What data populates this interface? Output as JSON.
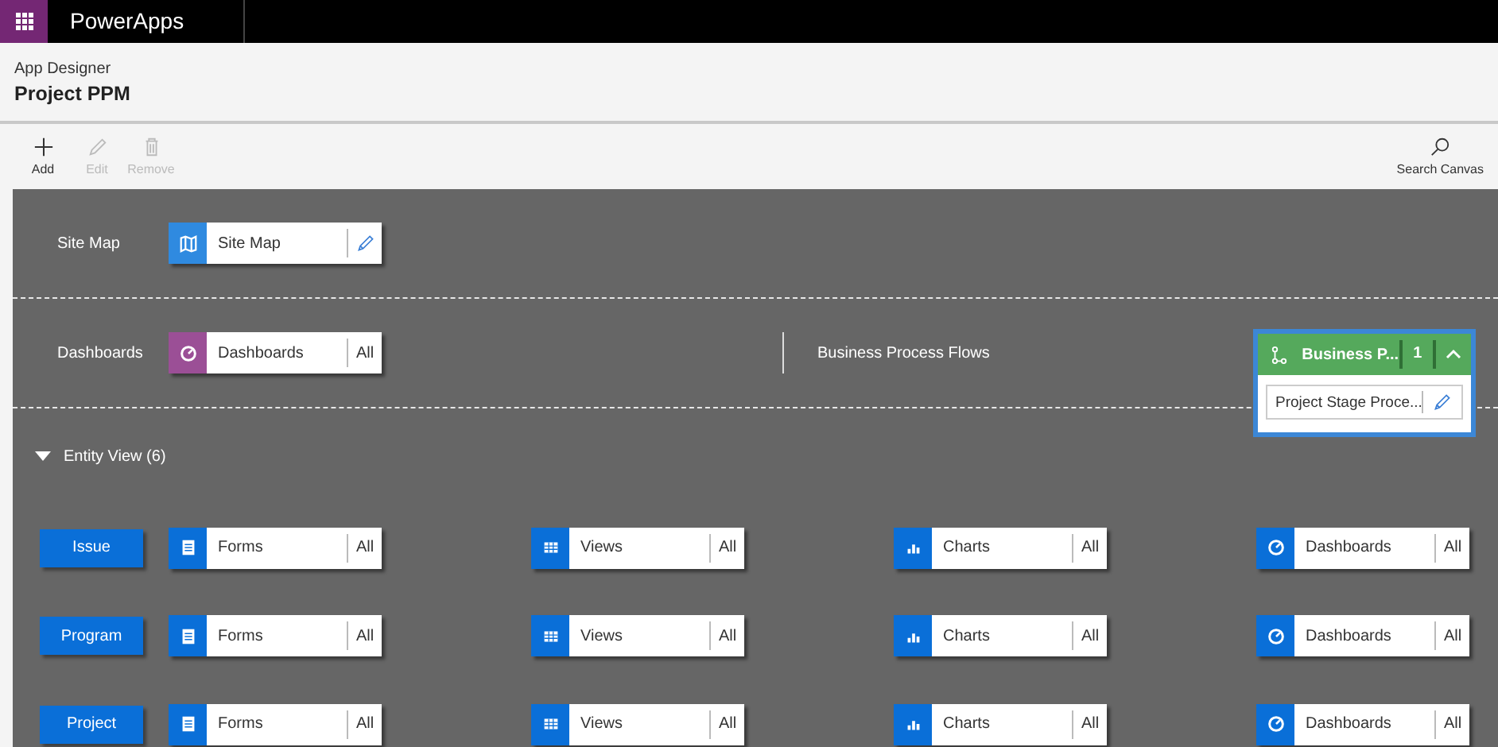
{
  "top_bar": {
    "app_name": "PowerApps"
  },
  "header": {
    "subtitle": "App Designer",
    "title": "Project PPM"
  },
  "toolbar": {
    "buttons": [
      {
        "label": "Add",
        "kind": "add",
        "disabled": false
      },
      {
        "label": "Edit",
        "kind": "edit",
        "disabled": true
      },
      {
        "label": "Remove",
        "kind": "remove",
        "disabled": true
      }
    ],
    "search": {
      "label": "Search Canvas"
    }
  },
  "site_map": {
    "label": "Site Map",
    "tile": {
      "label": "Site Map",
      "kind": "map",
      "color": "#2f8ae0"
    }
  },
  "dashboards": {
    "label": "Dashboards",
    "tile": {
      "label": "Dashboards",
      "kind": "dashboard",
      "color": "#9b4f96",
      "action_label": "All"
    }
  },
  "business_process_flows": {
    "label": "Business Process Flows",
    "card": {
      "title": "Business P...",
      "count": "1",
      "expanded": true,
      "items": [
        {
          "label": "Project Stage Proce..."
        }
      ]
    }
  },
  "entity_view": {
    "label": "Entity View (6)",
    "expanded": true,
    "entities": [
      {
        "name": "Issue",
        "tiles": [
          {
            "label": "Forms",
            "kind": "form",
            "action_label": "All"
          },
          {
            "label": "Views",
            "kind": "view",
            "action_label": "All"
          },
          {
            "label": "Charts",
            "kind": "chart",
            "action_label": "All"
          },
          {
            "label": "Dashboards",
            "kind": "dashboard",
            "action_label": "All"
          }
        ]
      },
      {
        "name": "Program",
        "tiles": [
          {
            "label": "Forms",
            "kind": "form",
            "action_label": "All"
          },
          {
            "label": "Views",
            "kind": "view",
            "action_label": "All"
          },
          {
            "label": "Charts",
            "kind": "chart",
            "action_label": "All"
          },
          {
            "label": "Dashboards",
            "kind": "dashboard",
            "action_label": "All"
          }
        ]
      },
      {
        "name": "Project",
        "tiles": [
          {
            "label": "Forms",
            "kind": "form",
            "action_label": "All"
          },
          {
            "label": "Views",
            "kind": "view",
            "action_label": "All"
          },
          {
            "label": "Charts",
            "kind": "chart",
            "action_label": "All"
          },
          {
            "label": "Dashboards",
            "kind": "dashboard",
            "action_label": "All"
          }
        ]
      }
    ]
  }
}
